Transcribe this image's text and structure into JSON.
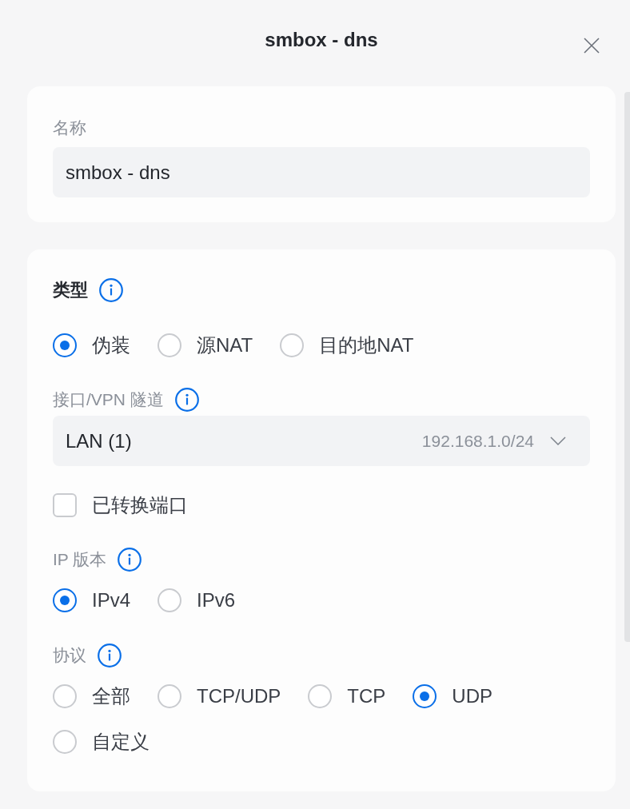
{
  "dialog": {
    "title": "smbox - dns"
  },
  "name_card": {
    "label": "名称",
    "value": "smbox - dns"
  },
  "type": {
    "title": "类型",
    "options": [
      {
        "label": "伪装",
        "selected": true
      },
      {
        "label": "源NAT",
        "selected": false
      },
      {
        "label": "目的地NAT",
        "selected": false
      }
    ]
  },
  "interface": {
    "label": "接口/VPN 隧道",
    "value": "LAN (1)",
    "detail": "192.168.1.0/24"
  },
  "translated_port": {
    "label": "已转换端口",
    "checked": false
  },
  "ip_version": {
    "label": "IP 版本",
    "options": [
      {
        "label": "IPv4",
        "selected": true
      },
      {
        "label": "IPv6",
        "selected": false
      }
    ]
  },
  "protocol": {
    "label": "协议",
    "options": [
      {
        "label": "全部",
        "selected": false
      },
      {
        "label": "TCP/UDP",
        "selected": false
      },
      {
        "label": "TCP",
        "selected": false
      },
      {
        "label": "UDP",
        "selected": true
      },
      {
        "label": "自定义",
        "selected": false
      }
    ]
  }
}
